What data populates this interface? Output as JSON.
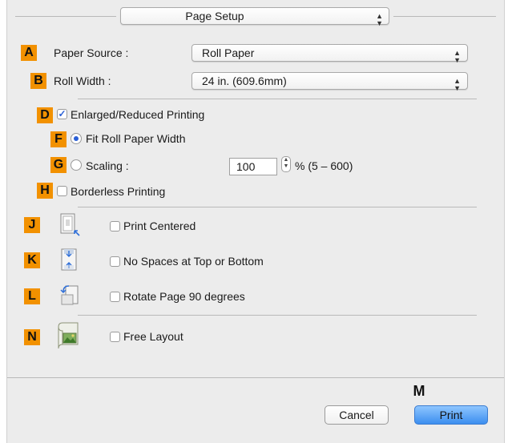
{
  "header": {
    "popup_label": "Page Setup",
    "popup_arrows": "▲▼"
  },
  "badges": {
    "A": "A",
    "B": "B",
    "D": "D",
    "F": "F",
    "G": "G",
    "H": "H",
    "J": "J",
    "K": "K",
    "L": "L",
    "N": "N",
    "M": "M"
  },
  "paper_source": {
    "label": "Paper Source :",
    "value": "Roll Paper"
  },
  "roll_width": {
    "label": "Roll Width :",
    "value": "24 in. (609.6mm)"
  },
  "enlarged": {
    "label": "Enlarged/Reduced Printing",
    "checked_glyph": "✓"
  },
  "fit_roll": {
    "label": "Fit Roll Paper Width"
  },
  "scaling": {
    "label": "Scaling :",
    "value": "100",
    "range": "% (5 – 600)",
    "stepper_glyph": "▲▼"
  },
  "borderless": {
    "label": "Borderless Printing"
  },
  "options": {
    "print_centered": {
      "label": "Print Centered",
      "icon": "print-centered-icon"
    },
    "no_spaces": {
      "label": "No Spaces at Top or Bottom",
      "icon": "no-spaces-icon"
    },
    "rotate": {
      "label": "Rotate Page 90 degrees",
      "icon": "rotate-page-icon"
    },
    "free_layout": {
      "label": "Free Layout",
      "icon": "free-layout-icon"
    }
  },
  "footer": {
    "cancel": "Cancel",
    "print": "Print"
  }
}
